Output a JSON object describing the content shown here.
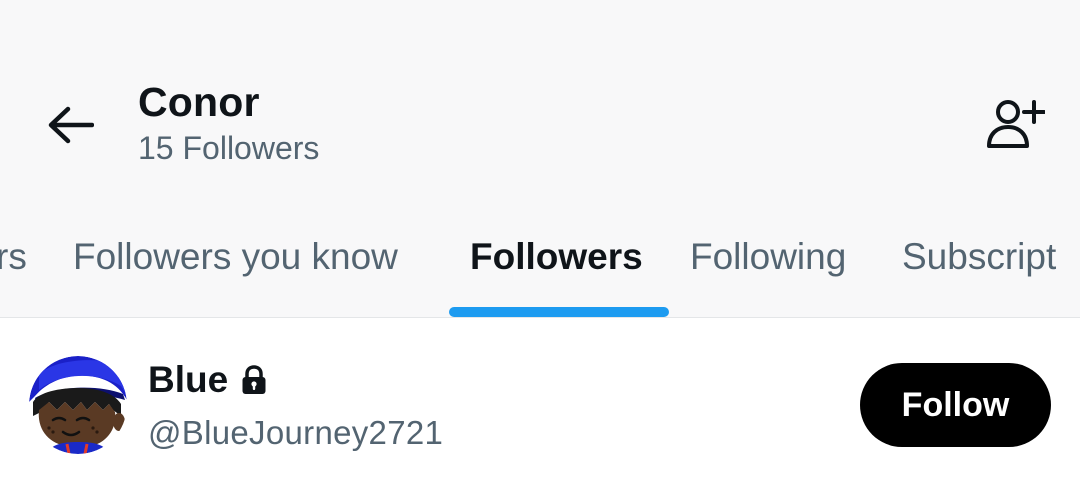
{
  "header": {
    "back_icon": "arrow-left-icon",
    "title": "Conor",
    "subtitle": "15 Followers",
    "add_user_icon": "person-add-icon"
  },
  "tabs": [
    {
      "label": "rs",
      "active": false
    },
    {
      "label": "Followers you know",
      "active": false
    },
    {
      "label": "Followers",
      "active": true
    },
    {
      "label": "Following",
      "active": false
    },
    {
      "label": "Subscript",
      "active": false
    }
  ],
  "users": [
    {
      "name": "Blue",
      "protected_icon": "lock-icon",
      "handle": "@BlueJourney2721",
      "follow_label": "Follow",
      "avatar_icon": "avatar-cartoon-blue-cap"
    }
  ],
  "colors": {
    "accent": "#1d9bf0",
    "text_primary": "#0f1419",
    "text_secondary": "#536471",
    "button_bg": "#000000",
    "header_bg": "#f8f8f9"
  }
}
